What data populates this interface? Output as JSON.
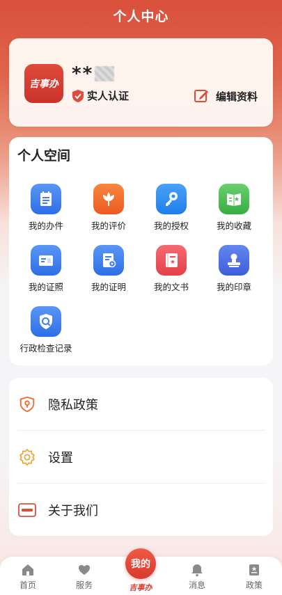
{
  "header": {
    "title": "个人中心"
  },
  "profile": {
    "logo_text": "吉事办",
    "username": "**",
    "verify_label": "实人认证",
    "edit_label": "编辑资料"
  },
  "space": {
    "title": "个人空间",
    "items": [
      {
        "label": "我的办件",
        "icon": "document-icon",
        "color": "#3d7ef0"
      },
      {
        "label": "我的评价",
        "icon": "flower-icon",
        "color": "#f0692e"
      },
      {
        "label": "我的授权",
        "icon": "key-icon",
        "color": "#2f8cf0"
      },
      {
        "label": "我的收藏",
        "icon": "book-icon",
        "color": "#4cbc52"
      },
      {
        "label": "我的证照",
        "icon": "id-card-icon",
        "color": "#3d7ef0"
      },
      {
        "label": "我的证明",
        "icon": "certificate-icon",
        "color": "#3d7ef0"
      },
      {
        "label": "我的文书",
        "icon": "notebook-icon",
        "color": "#ee5158"
      },
      {
        "label": "我的印章",
        "icon": "stamp-icon",
        "color": "#4c6fe4"
      },
      {
        "label": "行政检查记录",
        "icon": "inspection-shield-icon",
        "color": "#3d7ef0"
      }
    ]
  },
  "menu": {
    "items": [
      {
        "label": "隐私政策",
        "icon": "privacy-pin-icon"
      },
      {
        "label": "设置",
        "icon": "gear-icon"
      },
      {
        "label": "关于我们",
        "icon": "app-logo-small-icon"
      }
    ]
  },
  "tabbar": {
    "tabs": [
      {
        "label": "首页",
        "icon": "home-icon"
      },
      {
        "label": "服务",
        "icon": "heart-hands-icon"
      },
      {
        "label": "吉事办",
        "icon": "mine-bubble-icon",
        "bubble_text": "我的",
        "active": true
      },
      {
        "label": "消息",
        "icon": "bell-icon"
      },
      {
        "label": "政策",
        "icon": "policy-icon"
      }
    ]
  },
  "colors": {
    "brand": "#d9503b",
    "accent": "#f0692e"
  }
}
